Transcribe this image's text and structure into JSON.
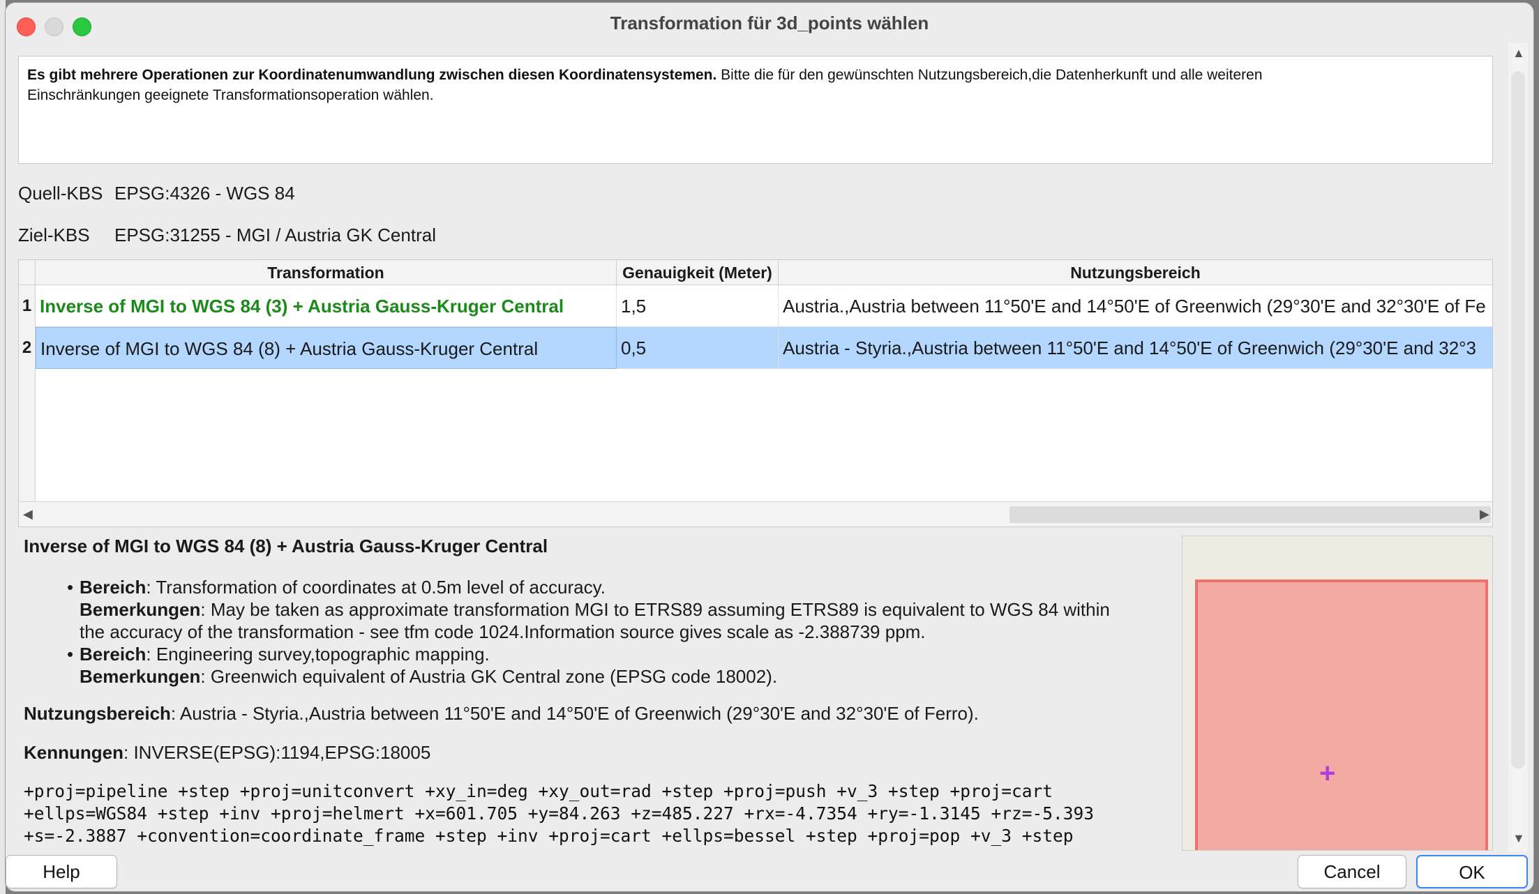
{
  "window": {
    "title": "Transformation für 3d_points wählen"
  },
  "info": {
    "bold": "Es gibt mehrere Operationen zur Koordinatenumwandlung zwischen diesen Koordinatensystemen.",
    "normal_line1": " Bitte die für den gewünschten Nutzungsbereich,die Datenherkunft und alle weiteren",
    "line2": "Einschränkungen geeignete Transformationsoperation wählen."
  },
  "source": {
    "label": "Quell-KBS",
    "value": "EPSG:4326 - WGS 84"
  },
  "target": {
    "label": "Ziel-KBS",
    "value": "EPSG:31255 - MGI / Austria GK Central"
  },
  "table": {
    "headers": [
      "Transformation",
      "Genauigkeit (Meter)",
      "Nutzungsbereich"
    ],
    "rows": [
      {
        "num": "1",
        "transformation": "Inverse of MGI to WGS 84 (3) + Austria Gauss-Kruger Central",
        "accuracy": "1,5",
        "area": "Austria.,Austria between 11°50'E and 14°50'E of Greenwich (29°30'E and 32°30'E of Fe"
      },
      {
        "num": "2",
        "transformation": "Inverse of MGI to WGS 84 (8) + Austria Gauss-Kruger Central",
        "accuracy": "0,5",
        "area": "Austria - Styria.,Austria between 11°50'E and 14°50'E of Greenwich (29°30'E and 32°3"
      }
    ]
  },
  "details": {
    "heading": "Inverse of MGI to WGS 84 (8) + Austria Gauss-Kruger Central",
    "bullets": [
      {
        "bereich_label": "Bereich",
        "bereich": ": Transformation of coordinates at 0.5m level of accuracy.",
        "bem_label": "Bemerkungen",
        "bem_line1": ": May be taken as approximate transformation MGI to ETRS89 assuming ETRS89 is equivalent to WGS 84 within",
        "bem_line2": "the accuracy of the transformation - see tfm code 1024.Information source gives scale as -2.388739 ppm."
      },
      {
        "bereich_label": "Bereich",
        "bereich": ": Engineering survey,topographic mapping.",
        "bem_label": "Bemerkungen",
        "bem_line1": ": Greenwich equivalent of Austria GK Central zone (EPSG code 18002)."
      }
    ],
    "nutzung_label": "Nutzungsbereich",
    "nutzung": ": Austria - Styria.,Austria between 11°50'E and 14°50'E of Greenwich (29°30'E and 32°30'E of Ferro).",
    "kennungen_label": "Kennungen",
    "kennungen": ": INVERSE(EPSG):1194,EPSG:18005",
    "proj": [
      "+proj=pipeline +step +proj=unitconvert +xy_in=deg +xy_out=rad +step +proj=push +v_3 +step +proj=cart",
      "+ellps=WGS84 +step +inv +proj=helmert +x=601.705 +y=84.263 +z=485.227 +rx=-4.7354 +ry=-1.3145 +rz=-5.393",
      "+s=-2.3887 +convention=coordinate_frame +step +inv +proj=cart +ellps=bessel +step +proj=pop +v_3 +step"
    ]
  },
  "buttons": {
    "help": "Help",
    "cancel": "Cancel",
    "ok": "OK"
  }
}
